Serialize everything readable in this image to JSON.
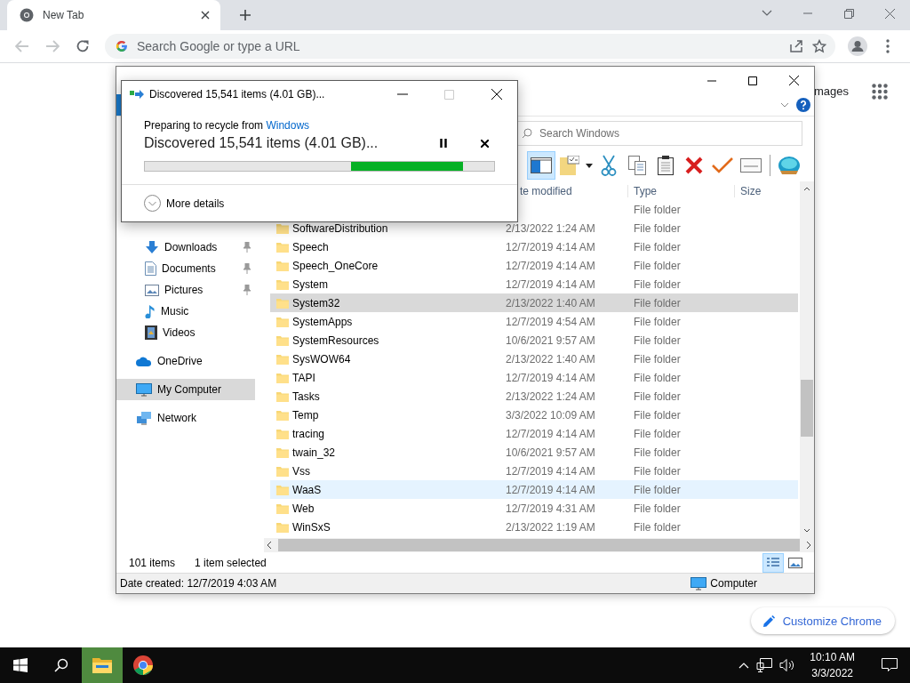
{
  "browser": {
    "tabs": [
      {
        "title": "New Tab",
        "selected": true
      }
    ],
    "omnibox": {
      "placeholder": "Search Google or type a URL"
    },
    "page": {
      "link": "mages",
      "customize_button": "Customize Chrome"
    }
  },
  "explorer": {
    "search": {
      "placeholder": "Search Windows"
    },
    "columns": [
      "te modified",
      "Type",
      "Size"
    ],
    "quick_access": [
      {
        "label": "Downloads",
        "kind": "downloads",
        "pinned": true
      },
      {
        "label": "Documents",
        "kind": "documents",
        "pinned": true
      },
      {
        "label": "Pictures",
        "kind": "pictures",
        "pinned": true
      },
      {
        "label": "Music",
        "kind": "music",
        "pinned": false
      },
      {
        "label": "Videos",
        "kind": "videos",
        "pinned": false
      }
    ],
    "locations": [
      {
        "label": "OneDrive",
        "kind": "cloud",
        "selected": false
      },
      {
        "label": "My Computer",
        "kind": "computer",
        "selected": true
      },
      {
        "label": "Network",
        "kind": "network",
        "selected": false
      }
    ],
    "rows": [
      {
        "type": "File folder",
        "selected": false,
        "hovered": false
      },
      {
        "name": "SoftwareDistribution",
        "modified": "2/13/2022 1:24 AM",
        "type": "File folder",
        "selected": false,
        "hovered": false
      },
      {
        "name": "Speech",
        "modified": "12/7/2019 4:14 AM",
        "type": "File folder",
        "selected": false,
        "hovered": false
      },
      {
        "name": "Speech_OneCore",
        "modified": "12/7/2019 4:14 AM",
        "type": "File folder",
        "selected": false,
        "hovered": false
      },
      {
        "name": "System",
        "modified": "12/7/2019 4:14 AM",
        "type": "File folder",
        "selected": false,
        "hovered": false
      },
      {
        "name": "System32",
        "modified": "2/13/2022 1:40 AM",
        "type": "File folder",
        "selected": true,
        "hovered": false
      },
      {
        "name": "SystemApps",
        "modified": "12/7/2019 4:54 AM",
        "type": "File folder",
        "selected": false,
        "hovered": false
      },
      {
        "name": "SystemResources",
        "modified": "10/6/2021 9:57 AM",
        "type": "File folder",
        "selected": false,
        "hovered": false
      },
      {
        "name": "SysWOW64",
        "modified": "2/13/2022 1:40 AM",
        "type": "File folder",
        "selected": false,
        "hovered": false
      },
      {
        "name": "TAPI",
        "modified": "12/7/2019 4:14 AM",
        "type": "File folder",
        "selected": false,
        "hovered": false
      },
      {
        "name": "Tasks",
        "modified": "2/13/2022 1:24 AM",
        "type": "File folder",
        "selected": false,
        "hovered": false
      },
      {
        "name": "Temp",
        "modified": "3/3/2022 10:09 AM",
        "type": "File folder",
        "selected": false,
        "hovered": false
      },
      {
        "name": "tracing",
        "modified": "12/7/2019 4:14 AM",
        "type": "File folder",
        "selected": false,
        "hovered": false
      },
      {
        "name": "twain_32",
        "modified": "10/6/2021 9:57 AM",
        "type": "File folder",
        "selected": false,
        "hovered": false
      },
      {
        "name": "Vss",
        "modified": "12/7/2019 4:14 AM",
        "type": "File folder",
        "selected": false,
        "hovered": false
      },
      {
        "name": "WaaS",
        "modified": "12/7/2019 4:14 AM",
        "type": "File folder",
        "selected": false,
        "hovered": true
      },
      {
        "name": "Web",
        "modified": "12/7/2019 4:31 AM",
        "type": "File folder",
        "selected": false,
        "hovered": false
      },
      {
        "name": "WinSxS",
        "modified": "2/13/2022 1:19 AM",
        "type": "File folder",
        "selected": false,
        "hovered": false
      }
    ],
    "status": {
      "count": "101 items",
      "selection": "1 item selected"
    },
    "details": {
      "text": "Date created: 12/7/2019 4:03 AM",
      "location": "Computer"
    }
  },
  "dialog": {
    "title": "Discovered 15,541 items (4.01 GB)...",
    "prefix": "Preparing to recycle from",
    "source": "Windows",
    "heading": "Discovered 15,541 items (4.01 GB)...",
    "more": "More details"
  },
  "taskbar": {
    "apps": [
      {
        "kind": "explorer",
        "active": true
      },
      {
        "kind": "chrome",
        "active": false
      }
    ],
    "time": "10:10 AM",
    "date": "3/3/2022"
  }
}
